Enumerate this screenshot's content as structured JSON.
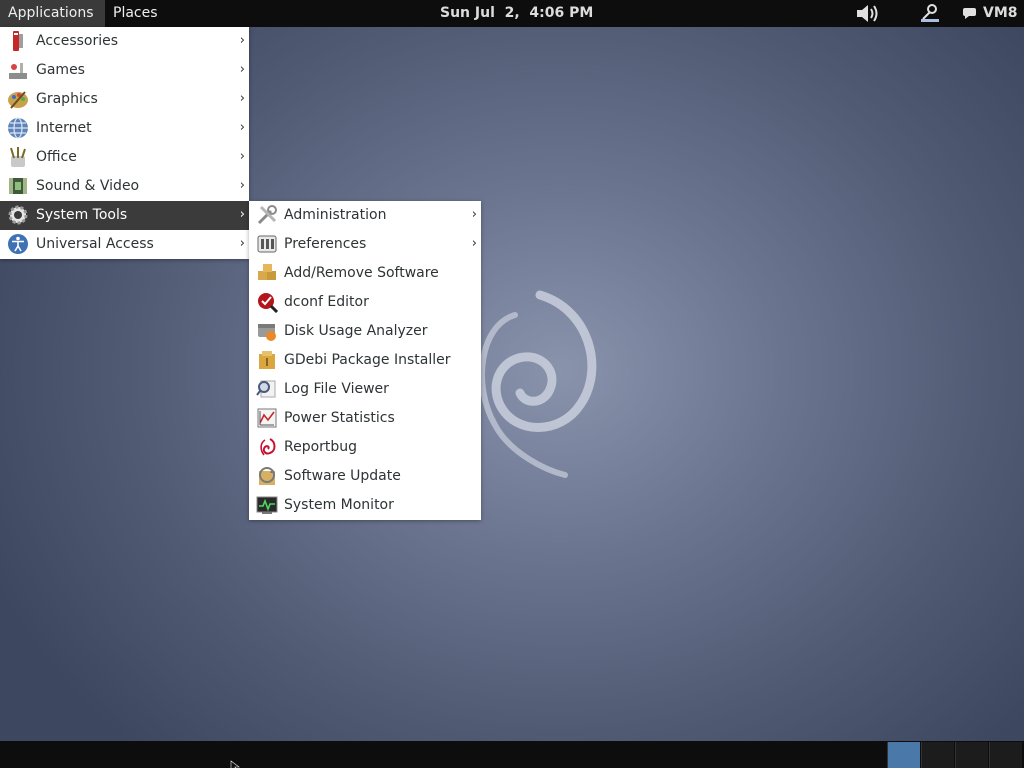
{
  "top_panel": {
    "applications_label": "Applications",
    "places_label": "Places",
    "clock": "Sun Jul  2,  4:06 PM",
    "user_label": "VM8",
    "icons": [
      "volume-icon",
      "user-status-icon",
      "chat-icon"
    ]
  },
  "main_menu": {
    "items": [
      {
        "label": "Accessories",
        "icon": "accessories-icon"
      },
      {
        "label": "Games",
        "icon": "games-icon"
      },
      {
        "label": "Graphics",
        "icon": "graphics-icon"
      },
      {
        "label": "Internet",
        "icon": "internet-globe-icon"
      },
      {
        "label": "Office",
        "icon": "office-icon"
      },
      {
        "label": "Sound & Video",
        "icon": "sound-video-icon"
      },
      {
        "label": "System Tools",
        "icon": "gear-icon",
        "selected": true
      },
      {
        "label": "Universal Access",
        "icon": "accessibility-icon"
      }
    ],
    "submenu_arrow": "›"
  },
  "sub_menu": {
    "items": [
      {
        "label": "Administration",
        "icon": "tools-icon",
        "has_submenu": true
      },
      {
        "label": "Preferences",
        "icon": "preferences-icon",
        "has_submenu": true
      },
      {
        "label": "Add/Remove Software",
        "icon": "package-icon"
      },
      {
        "label": "dconf Editor",
        "icon": "dconf-icon"
      },
      {
        "label": "Disk Usage Analyzer",
        "icon": "disk-usage-icon"
      },
      {
        "label": "GDebi Package Installer",
        "icon": "gdebi-icon"
      },
      {
        "label": "Log File Viewer",
        "icon": "log-viewer-icon"
      },
      {
        "label": "Power Statistics",
        "icon": "power-stats-icon"
      },
      {
        "label": "Reportbug",
        "icon": "debian-swirl-icon"
      },
      {
        "label": "Software Update",
        "icon": "software-update-icon"
      },
      {
        "label": "System Monitor",
        "icon": "system-monitor-icon"
      }
    ]
  },
  "workspaces": {
    "count": 4,
    "active_index": 0
  },
  "colors": {
    "panel_bg": "#0d0d0d",
    "menu_selected": "#3b3b3b",
    "workspace_active": "#4a78a8",
    "desktop_center": "#8a93ac",
    "desktop_edge": "#3e4760"
  }
}
